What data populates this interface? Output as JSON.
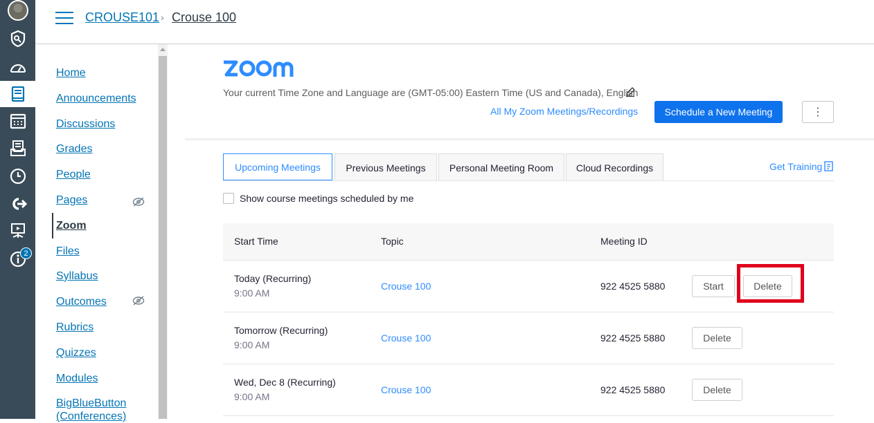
{
  "header": {
    "breadcrumb_course": "CROUSE101",
    "breadcrumb_separator": "›",
    "breadcrumb_page": "Crouse 100"
  },
  "global_nav": {
    "icons": [
      "account-avatar",
      "admin-shield-icon",
      "dashboard-icon",
      "courses-icon",
      "calendar-icon",
      "inbox-icon",
      "history-icon",
      "commons-icon",
      "studio-icon",
      "help-icon"
    ],
    "help_badge": "2"
  },
  "course_nav": {
    "items": [
      {
        "label": "Home"
      },
      {
        "label": "Announcements"
      },
      {
        "label": "Discussions"
      },
      {
        "label": "Grades"
      },
      {
        "label": "People"
      },
      {
        "label": "Pages",
        "hidden": true
      },
      {
        "label": "Zoom",
        "active": true
      },
      {
        "label": "Files"
      },
      {
        "label": "Syllabus"
      },
      {
        "label": "Outcomes",
        "hidden": true
      },
      {
        "label": "Rubrics"
      },
      {
        "label": "Quizzes"
      },
      {
        "label": "Modules"
      },
      {
        "label": "BigBlueButton"
      },
      {
        "label": "(Conferences)"
      }
    ]
  },
  "zoom": {
    "logo_text": "zoom",
    "timezone_text": "Your current Time Zone and Language are (GMT-05:00) Eastern Time (US and Canada), English",
    "all_link": "All My Zoom Meetings/Recordings",
    "schedule_button": "Schedule a New Meeting",
    "more_button": "⋮",
    "tabs": [
      {
        "label": "Upcoming Meetings",
        "active": true
      },
      {
        "label": "Previous Meetings"
      },
      {
        "label": "Personal Meeting Room"
      },
      {
        "label": "Cloud Recordings"
      }
    ],
    "get_training": "Get Training",
    "checkbox_label": "Show course meetings scheduled by me",
    "columns": [
      "Start Time",
      "Topic",
      "Meeting ID"
    ],
    "meetings": [
      {
        "time1": "Today (Recurring)",
        "time2": "9:00 AM",
        "topic": "Crouse 100",
        "meeting_id": "922 4525 5880",
        "start": "Start",
        "delete": "Delete"
      },
      {
        "time1": "Tomorrow (Recurring)",
        "time2": "9:00 AM",
        "topic": "Crouse 100",
        "meeting_id": "922 4525 5880",
        "delete": "Delete"
      },
      {
        "time1": "Wed, Dec 8 (Recurring)",
        "time2": "9:00 AM",
        "topic": "Crouse 100",
        "meeting_id": "922 4525 5880",
        "delete": "Delete"
      }
    ]
  },
  "colors": {
    "nav_bg": "#394b58",
    "canvas_link": "#0374b5",
    "zoom_blue": "#0e72ed",
    "zoom_link": "#2d8cff",
    "highlight": "#e0001a"
  }
}
